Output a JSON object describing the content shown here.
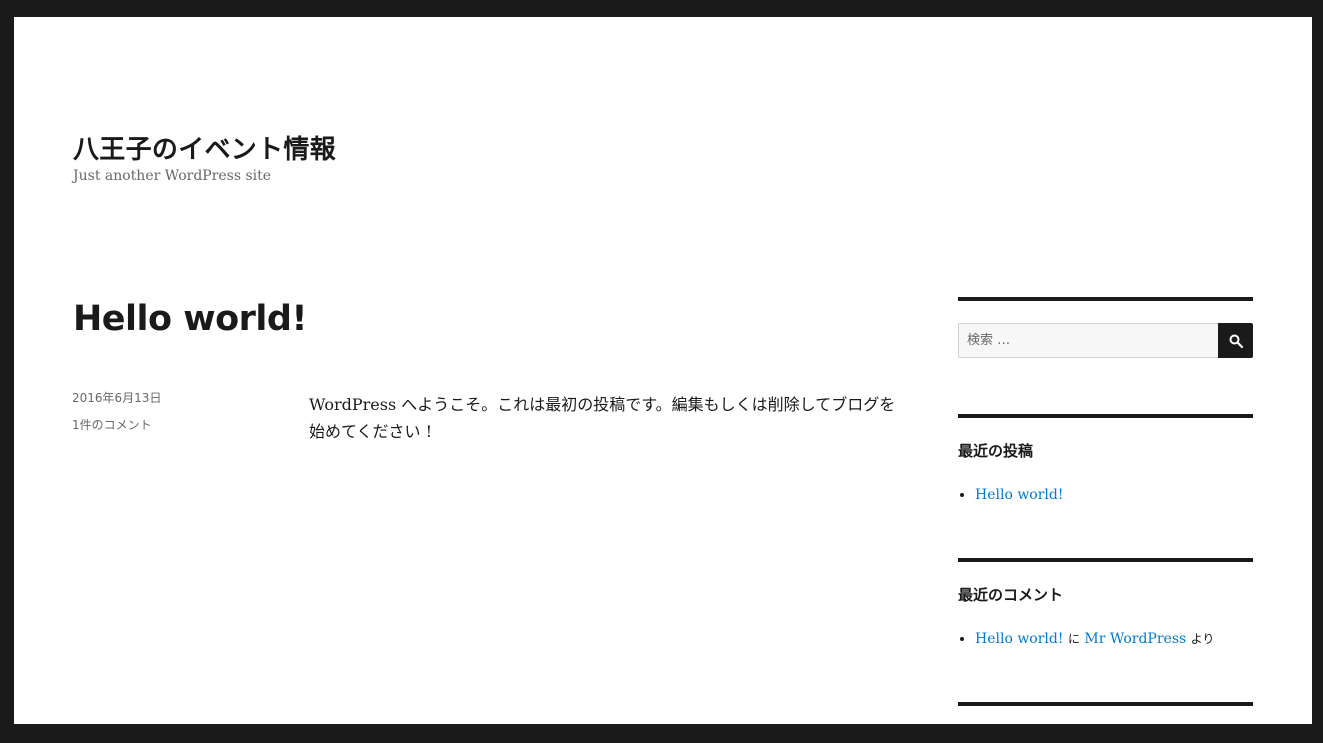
{
  "site": {
    "title": "八王子のイベント情報",
    "tagline": "Just another WordPress site"
  },
  "post": {
    "title": "Hello world!",
    "date": "2016年6月13日",
    "comments": "1件のコメント",
    "content": "WordPress へようこそ。これは最初の投稿です。編集もしくは削除してブログを始めてください !"
  },
  "sidebar": {
    "search": {
      "placeholder": "検索 …",
      "icon": "search-icon"
    },
    "recent_posts": {
      "title": "最近の投稿",
      "items": [
        {
          "label": "Hello world!"
        }
      ]
    },
    "recent_comments": {
      "title": "最近のコメント",
      "items": [
        {
          "post": "Hello world!",
          "connector": "に",
          "author": "Mr WordPress",
          "suffix": "より"
        }
      ]
    }
  },
  "colors": {
    "link": "#007acc",
    "text": "#1a1a1a",
    "muted": "#686868",
    "frame": "#1a1a1a"
  }
}
